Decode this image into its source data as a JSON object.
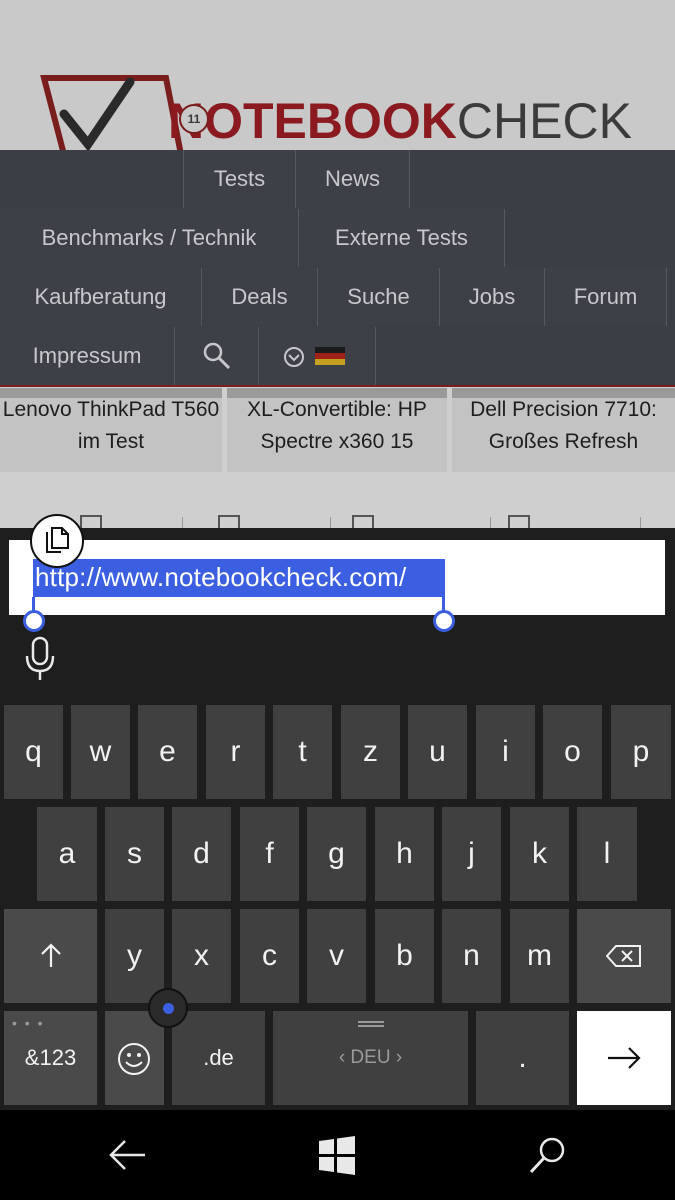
{
  "site": {
    "logo": {
      "part1": "NOTEBOOK",
      "part2": "CHECK",
      "badge": "11"
    },
    "nav_rows": [
      [
        "Tests",
        "News"
      ],
      [
        "Benchmarks / Technik",
        "Externe Tests"
      ],
      [
        "Kaufberatung",
        "Deals",
        "Suche",
        "Jobs",
        "Forum"
      ],
      [
        "Impressum"
      ]
    ],
    "teasers": [
      "Lenovo ThinkPad T560 im Test",
      "XL-Convertible: HP Spectre x360 15",
      "Dell Precision 7710: Großes Refresh"
    ]
  },
  "address_bar": {
    "value": "http://www.notebookcheck.com/"
  },
  "keyboard": {
    "row1": [
      "q",
      "w",
      "e",
      "r",
      "t",
      "z",
      "u",
      "i",
      "o",
      "p"
    ],
    "row2": [
      "a",
      "s",
      "d",
      "f",
      "g",
      "h",
      "j",
      "k",
      "l"
    ],
    "row3": [
      "y",
      "x",
      "c",
      "v",
      "b",
      "n",
      "m"
    ],
    "symbols_key": "&123",
    "domain_key": ".de",
    "space_key": "‹ DEU ›",
    "period_key": "."
  },
  "colors": {
    "selection": "#3b5fe0",
    "brand_red": "#8a1a1f"
  }
}
